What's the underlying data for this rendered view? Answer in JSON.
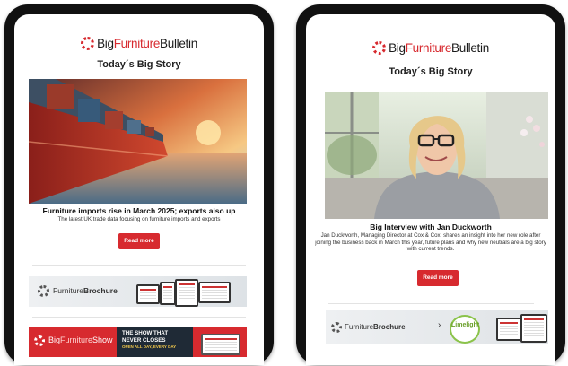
{
  "left_tablet": {
    "logo": {
      "part1": "Big",
      "part2": "Furniture",
      "part3": "Bulletin"
    },
    "heading": "Today´s Big Story",
    "story": {
      "title": "Furniture imports rise in March 2025; exports also up",
      "description": "The latest UK trade data focusing on furniture imports and exports",
      "button_label": "Read more"
    },
    "brochure_banner": {
      "part1": "Furniture",
      "part2": "Brochure"
    },
    "show_banner": {
      "part1": "Big",
      "part2": "Furniture",
      "part3": "Show",
      "line1": "THE SHOW THAT",
      "line2": "NEVER CLOSES",
      "line3": "OPEN ALL DAY, EVERY DAY"
    }
  },
  "right_tablet": {
    "logo": {
      "part1": "Big",
      "part2": "Furniture",
      "part3": "Bulletin"
    },
    "heading": "Today´s Big Story",
    "story": {
      "title": "Big Interview with Jan Duckworth",
      "description": "Jan Duckworth, Managing Director at Cox & Cox, shares an insight into her new role after joining the business back in March this year, future plans and why new neutrals are a big story with current trends.",
      "button_label": "Read more"
    },
    "brochure_banner": {
      "part1": "Furniture",
      "part2": "Brochure",
      "partner": "Limelight"
    }
  },
  "colors": {
    "brand_red": "#d72a2f",
    "device_frame": "#111111"
  }
}
